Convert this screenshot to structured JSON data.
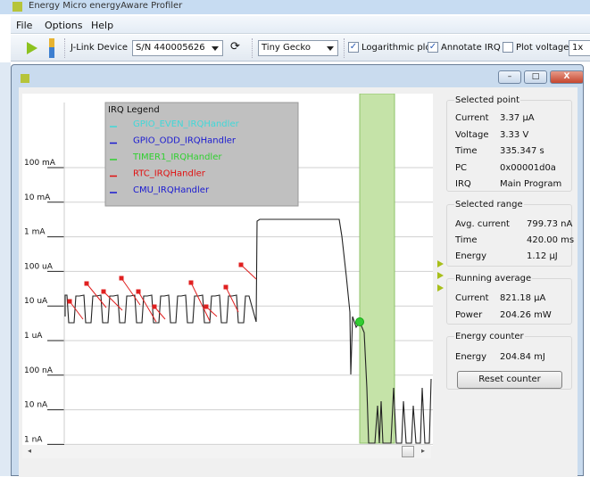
{
  "app": {
    "title": "Energy Micro energyAware Profiler"
  },
  "menu": [
    "File",
    "Options",
    "Help"
  ],
  "toolbar": {
    "jlink_label": "J-Link Device",
    "device_serial": "S/N 440005626",
    "target": "Tiny Gecko",
    "log_plot_label": "Logarithmic plot",
    "log_plot_checked": true,
    "annotate_irq_label": "Annotate IRQ",
    "annotate_irq_checked": true,
    "plot_voltage_label": "Plot voltage",
    "plot_voltage_checked": false,
    "zoom": "1x"
  },
  "window_buttons": {
    "minimize": "–",
    "maximize": "□",
    "close": "X"
  },
  "chart_data": {
    "type": "line",
    "y_scale": "log",
    "y_ticks": [
      "100 mA",
      "10 mA",
      "1 mA",
      "100 uA",
      "10 uA",
      "1 uA",
      "100 nA",
      "10 nA",
      "1 nA"
    ],
    "ylim": [
      "1 nA",
      "100 mA"
    ],
    "grid": true,
    "legend": {
      "title": "IRQ Legend",
      "placement": "top-left",
      "entries": [
        {
          "name": "GPIO_EVEN_IRQHandler",
          "color": "#40d8d8"
        },
        {
          "name": "GPIO_ODD_IRQHandler",
          "color": "#1a1ad0"
        },
        {
          "name": "TIMER1_IRQHandler",
          "color": "#30d030"
        },
        {
          "name": "RTC_IRQHandler",
          "color": "#e01010"
        },
        {
          "name": "CMU_IRQHandler",
          "color": "#1a1ad0"
        }
      ]
    },
    "selection_color": "#9bd16a",
    "selected_point_color": "#22c022"
  },
  "selected_point": {
    "title": "Selected point",
    "rows": [
      [
        "Current",
        "3.37 µA"
      ],
      [
        "Voltage",
        "3.33 V"
      ],
      [
        "Time",
        "335.347 s"
      ],
      [
        "PC",
        "0x00001d0a"
      ],
      [
        "IRQ",
        "Main Program"
      ]
    ]
  },
  "selected_range": {
    "title": "Selected range",
    "rows": [
      [
        "Avg. current",
        "799.73 nA"
      ],
      [
        "Time",
        "420.00 ms"
      ],
      [
        "Energy",
        "1.12 µJ"
      ]
    ]
  },
  "running_average": {
    "title": "Running average",
    "rows": [
      [
        "Current",
        "821.18 µA"
      ],
      [
        "Power",
        "204.26 mW"
      ]
    ]
  },
  "energy_counter": {
    "title": "Energy counter",
    "rows": [
      [
        "Energy",
        "204.84 mJ"
      ]
    ],
    "reset_label": "Reset counter"
  }
}
